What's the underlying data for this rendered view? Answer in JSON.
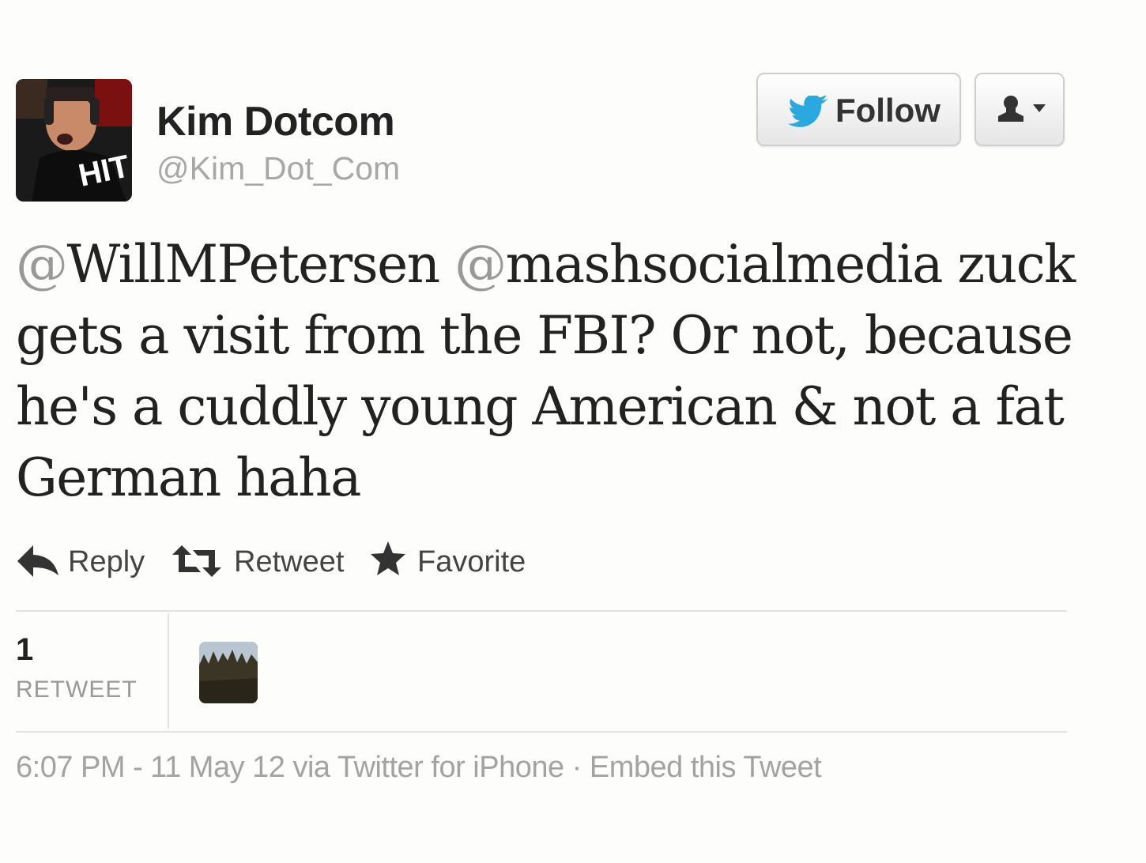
{
  "user": {
    "display_name": "Kim Dotcom",
    "screen_name": "@Kim_Dot_Com",
    "avatar_text": "HIT"
  },
  "header": {
    "follow_label": "Follow",
    "bird_icon": "twitter-bird-icon",
    "user_menu_icon": "person-icon"
  },
  "tweet": {
    "lines": [
      [
        "@WillMPetersen",
        " ",
        "@mashsocialmedia",
        " zuck"
      ],
      [
        "gets a visit from the FBI? Or not, because"
      ],
      [
        "he's a cuddly young American & not a fat"
      ],
      [
        "German haha"
      ]
    ],
    "mention_1": "@WillMPetersen",
    "mention_2": "@mashsocialmedia",
    "line1_rest": " zuck",
    "line2": "gets a visit from the FBI? Or not, because",
    "line3": "he's a cuddly young American & not a fat",
    "line4": "German haha"
  },
  "actions": {
    "reply": "Reply",
    "retweet": "Retweet",
    "favorite": "Favorite"
  },
  "stats": {
    "retweet_count": "1",
    "retweet_label": "RETWEET"
  },
  "footer": {
    "time": "6:07 PM - 11 May 12",
    "via_prefix": " via ",
    "source": "Twitter for iPhone",
    "separator": " · ",
    "embed": "Embed this Tweet"
  },
  "colors": {
    "background": "#fdfdfb",
    "twitter_blue": "#2aa9e0",
    "muted_text": "#a3a3a3",
    "mention_gray": "#999999"
  }
}
